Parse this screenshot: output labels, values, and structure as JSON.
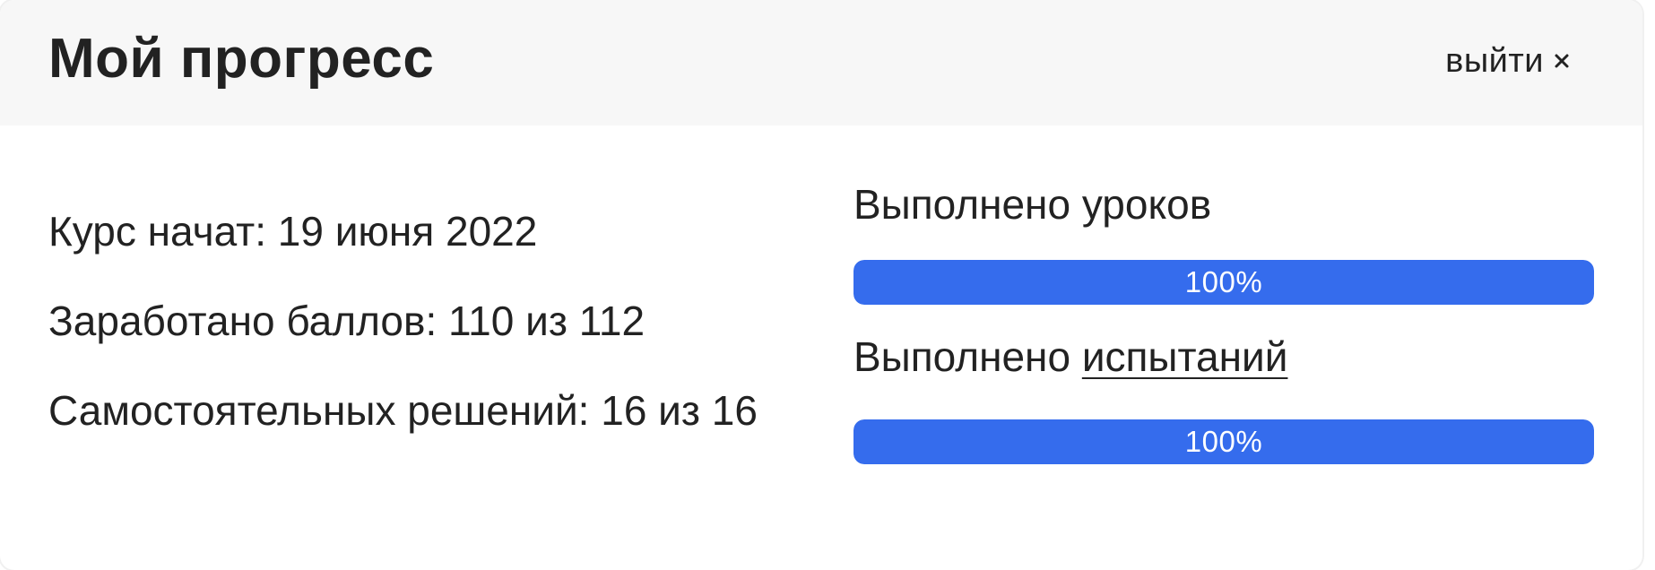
{
  "header": {
    "title": "Мой прогресс",
    "exit_label": "выйти"
  },
  "stats": {
    "course_started": "Курс начат: 19 июня 2022",
    "points_earned": "Заработано баллов: 110 из 112",
    "independent_solutions": "Самостоятельных решений: 16 из 16"
  },
  "progress": {
    "lessons": {
      "label": "Выполнено уроков",
      "value_text": "100%",
      "value": 1.0
    },
    "trials": {
      "label_prefix": "Выполнено ",
      "label_link": "испытаний",
      "value_text": "100%",
      "value": 1.0
    }
  },
  "colors": {
    "accent": "#356ced",
    "header_bg": "#f7f7f7",
    "text": "#222222"
  },
  "icons": {
    "exit": "close-icon"
  }
}
